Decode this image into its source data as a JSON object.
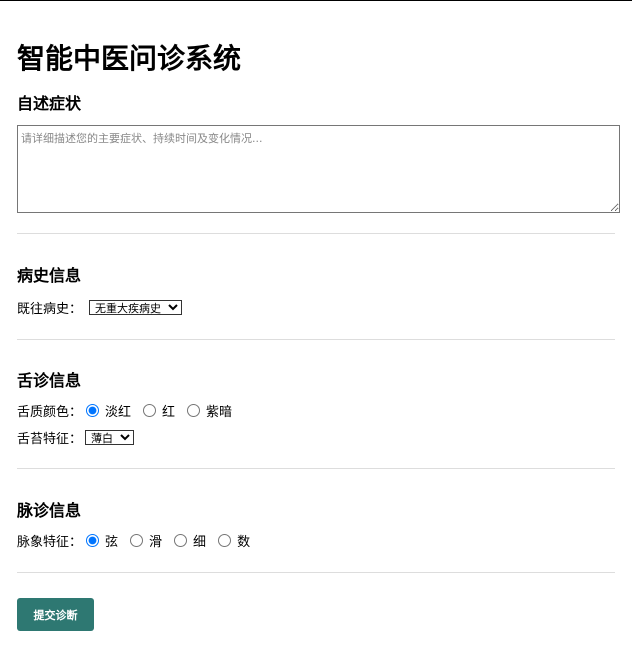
{
  "title": "智能中医问诊系统",
  "symptoms": {
    "heading": "自述症状",
    "placeholder": "请详细描述您的主要症状、持续时间及变化情况...",
    "value": ""
  },
  "history": {
    "heading": "病史信息",
    "label": "既往病史：",
    "selected": "无重大疾病史"
  },
  "tongue": {
    "heading": "舌诊信息",
    "color_label": "舌质颜色：",
    "color_options": [
      "淡红",
      "红",
      "紫暗"
    ],
    "color_selected": "淡红",
    "coating_label": "舌苔特征：",
    "coating_selected": "薄白"
  },
  "pulse": {
    "heading": "脉诊信息",
    "label": "脉象特征：",
    "options": [
      "弦",
      "滑",
      "细",
      "数"
    ],
    "selected": "弦"
  },
  "submit_label": "提交诊断",
  "colors": {
    "button": "#2e7872",
    "radio_accent": "#0075ff",
    "divider": "#dddddd"
  }
}
